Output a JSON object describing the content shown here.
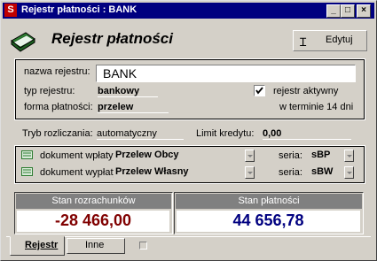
{
  "window": {
    "title": "Rejestr płatności : BANK",
    "app_icon": "S"
  },
  "header": {
    "title": "Rejestr płatności",
    "edit_label": "Edytuj"
  },
  "register": {
    "name_label": "nazwa rejestru:",
    "name_value": "BANK",
    "type_label": "typ rejestru:",
    "type_value": "bankowy",
    "active_label": "rejestr aktywny",
    "payment_label": "forma płatności:",
    "payment_value": "przelew",
    "term_text": "w terminie 14 dni"
  },
  "settlement": {
    "mode_label": "Tryb rozliczania:",
    "mode_value": "automatyczny",
    "credit_label": "Limit kredytu:",
    "credit_value": "0,00"
  },
  "documents": {
    "in_label": "dokument wpłaty:",
    "in_value": "Przelew Obcy",
    "in_series_label": "seria:",
    "in_series_value": "sBP",
    "out_label": "dokument wypłaty:",
    "out_value": "Przelew Własny",
    "out_series_label": "seria:",
    "out_series_value": "sBW"
  },
  "balances": {
    "settlements_label": "Stan rozrachunków",
    "settlements_value": "-28 466,00",
    "payments_label": "Stan płatności",
    "payments_value": "44 656,78"
  },
  "tabs": {
    "register": "Rejestr",
    "other": "Inne"
  },
  "colors": {
    "negative": "#800000",
    "positive": "#000080",
    "titlebar": "#000080"
  }
}
